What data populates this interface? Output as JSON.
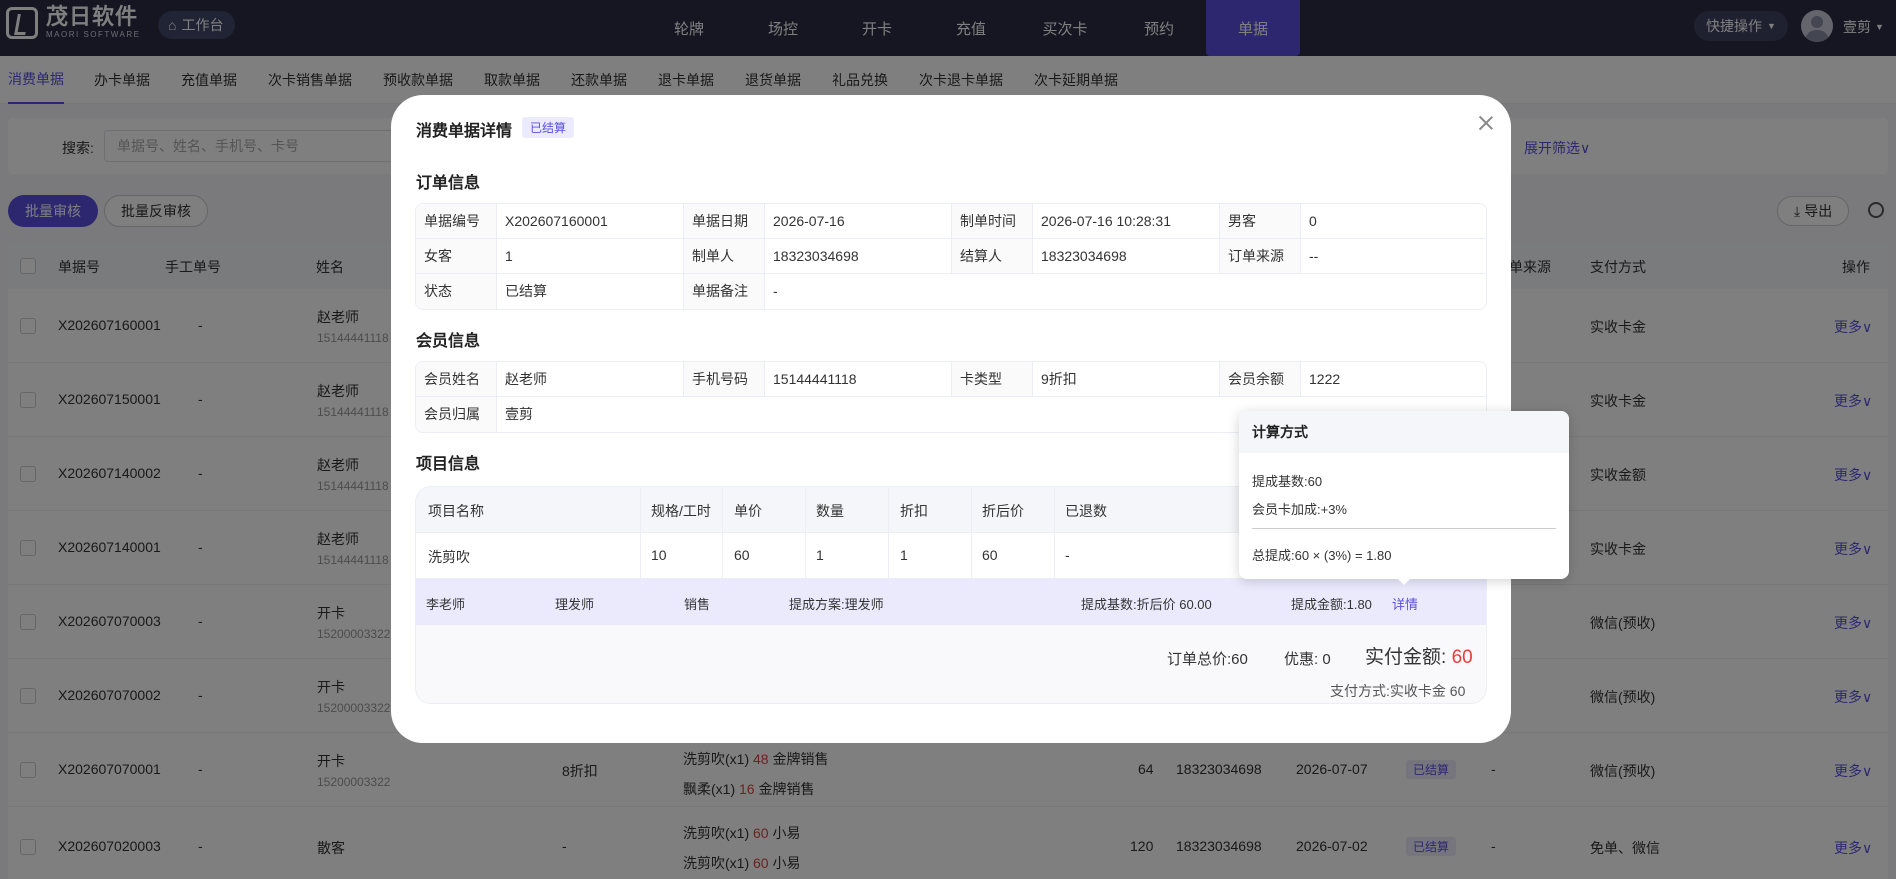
{
  "app": {
    "logo_cn": "茂日软件",
    "logo_en": "MAORI SOFTWARE",
    "workbench": "工作台",
    "nav": [
      "轮牌",
      "场控",
      "开卡",
      "充值",
      "买次卡",
      "预约",
      "单据"
    ],
    "quick_actions": "快捷操作",
    "username": "壹剪",
    "brand_color": "#5b4fe1"
  },
  "tabs": [
    "消费单据",
    "办卡单据",
    "充值单据",
    "次卡销售单据",
    "预收款单据",
    "取款单据",
    "还款单据",
    "退卡单据",
    "退货单据",
    "礼品兑换",
    "次卡退卡单据",
    "次卡延期单据"
  ],
  "filter": {
    "label": "搜索:",
    "placeholder": "单据号、姓名、手机号、卡号",
    "expand": "展开筛选"
  },
  "toolbar": {
    "batch_audit": "批量审核",
    "batch_unaudit": "批量反审核",
    "export": "导出"
  },
  "table": {
    "headers": {
      "no": "单据号",
      "manual": "手工单号",
      "name": "姓名",
      "source": "单来源",
      "pay": "支付方式",
      "op": "操作"
    },
    "rows": [
      {
        "no": "X202607160001",
        "manual": "-",
        "name": "赵老师",
        "phone": "15144441118",
        "pay": "实收卡金",
        "more": "更多"
      },
      {
        "no": "X202607150001",
        "manual": "-",
        "name": "赵老师",
        "phone": "15144441118",
        "pay": "实收卡金",
        "more": "更多"
      },
      {
        "no": "X202607140002",
        "manual": "-",
        "name": "赵老师",
        "phone": "15144441118",
        "pay": "实收金额",
        "more": "更多"
      },
      {
        "no": "X202607140001",
        "manual": "-",
        "name": "赵老师",
        "phone": "15144441118",
        "pay": "实收卡金",
        "more": "更多"
      },
      {
        "no": "X202607070003",
        "manual": "-",
        "name": "开卡",
        "phone": "15200003322",
        "pay": "微信(预收)",
        "more": "更多"
      },
      {
        "no": "X202607070002",
        "manual": "-",
        "name": "开卡",
        "phone": "15200003322",
        "pay": "微信(预收)",
        "more": "更多"
      },
      {
        "no": "X202607070001",
        "manual": "-",
        "name": "开卡",
        "phone": "15200003322",
        "card": "8折扣",
        "item1": "洗剪吹(x1)",
        "item1_price": "48",
        "item1_staff": "金牌销售",
        "item2": "飘柔(x1)",
        "item2_price": "16",
        "item2_staff": "金牌销售",
        "total": "64",
        "operator": "18323034698",
        "date": "2026-07-07",
        "status": "已结算",
        "source": "-",
        "pay": "微信(预收)",
        "more": "更多"
      },
      {
        "no": "X202607020003",
        "manual": "-",
        "name": "散客",
        "phone": "",
        "card": "-",
        "item1": "洗剪吹(x1)",
        "item1_price": "60",
        "item1_staff": "小易",
        "item2": "洗剪吹(x1)",
        "item2_price": "60",
        "item2_staff": "小易",
        "total": "120",
        "operator": "18323034698",
        "date": "2026-07-02",
        "status": "已结算",
        "source": "-",
        "pay": "免单、微信",
        "more": "更多"
      }
    ]
  },
  "modal": {
    "title": "消费单据详情",
    "status_badge": "已结算",
    "order_section": "订单信息",
    "order": {
      "r1": [
        [
          "单据编号",
          "X202607160001"
        ],
        [
          "单据日期",
          "2026-07-16"
        ],
        [
          "制单时间",
          "2026-07-16 10:28:31"
        ],
        [
          "男客",
          "0"
        ]
      ],
      "r2": [
        [
          "女客",
          "1"
        ],
        [
          "制单人",
          "18323034698"
        ],
        [
          "结算人",
          "18323034698"
        ],
        [
          "订单来源",
          "--"
        ]
      ],
      "r3": [
        [
          "状态",
          "已结算"
        ],
        [
          "单据备注",
          "-"
        ]
      ]
    },
    "member_section": "会员信息",
    "member": {
      "r1": [
        [
          "会员姓名",
          "赵老师"
        ],
        [
          "手机号码",
          "15144441118"
        ],
        [
          "卡类型",
          "9折扣"
        ],
        [
          "会员余额",
          "1222"
        ]
      ],
      "r2": [
        [
          "会员归属",
          "壹剪"
        ]
      ]
    },
    "project_section": "项目信息",
    "project": {
      "headers": [
        "项目名称",
        "规格/工时",
        "单价",
        "数量",
        "折扣",
        "折后价",
        "已退数"
      ],
      "row": [
        "洗剪吹",
        "10",
        "60",
        "1",
        "1",
        "60",
        "-"
      ],
      "staff": {
        "name": "李老师",
        "role": "理发师",
        "type": "销售",
        "plan": "提成方案:理发师",
        "base": "提成基数:折后价 60.00",
        "amount": "提成金额:1.80",
        "detail": "详情"
      }
    },
    "summary": {
      "total": "订单总价:60",
      "discount": "优惠: 0",
      "paid_label": "实付金额:",
      "paid_value": "60",
      "pay_method": "支付方式:实收卡金 60"
    }
  },
  "popover": {
    "title": "计算方式",
    "base": "提成基数:60",
    "bonus": "会员卡加成:+3%",
    "total": "总提成:60 × (3%) = 1.80"
  }
}
